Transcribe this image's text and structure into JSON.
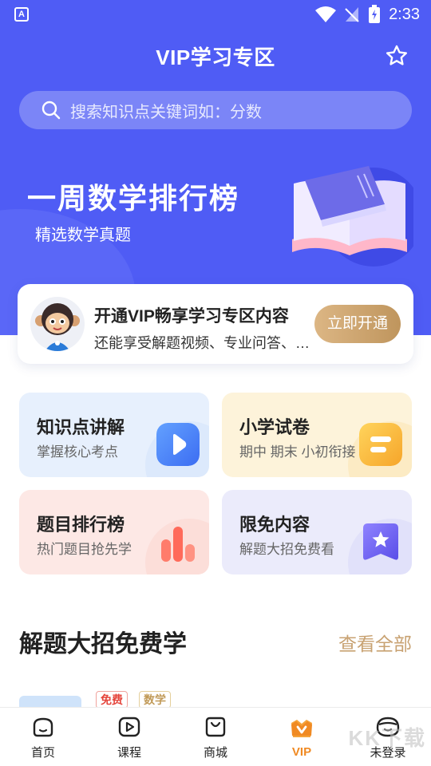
{
  "status_bar": {
    "time": "2:33",
    "notice_glyph": "A"
  },
  "header": {
    "title": "VIP学习专区"
  },
  "search": {
    "placeholder": "搜索知识点关键词如：分数"
  },
  "banner": {
    "title": "一周数学排行榜",
    "subtitle": "精选数学真题"
  },
  "vip_card": {
    "title": "开通VIP畅享学习专区内容",
    "description": "还能享受解题视频、专业问答、…",
    "button": "立即开通"
  },
  "tiles": [
    {
      "title": "知识点讲解",
      "subtitle": "掌握核心考点",
      "icon": "play-icon"
    },
    {
      "title": "小学试卷",
      "subtitle": "期中 期末 小初衔接",
      "icon": "paper-icon"
    },
    {
      "title": "题目排行榜",
      "subtitle": "热门题目抢先学",
      "icon": "bar-chart-icon"
    },
    {
      "title": "限免内容",
      "subtitle": "解题大招免费看",
      "icon": "star-badge-icon"
    }
  ],
  "section": {
    "title": "解题大招免费学",
    "more": "查看全部"
  },
  "preview_item": {
    "tags": [
      "免费",
      "数学"
    ]
  },
  "tabbar": {
    "items": [
      {
        "label": "首页",
        "icon": "home-icon"
      },
      {
        "label": "课程",
        "icon": "course-icon"
      },
      {
        "label": "商城",
        "icon": "shop-icon"
      },
      {
        "label": "VIP",
        "icon": "vip-icon",
        "active": true
      },
      {
        "label": "未登录",
        "icon": "profile-icon"
      }
    ]
  },
  "watermark": "KK下载",
  "colors": {
    "primary": "#4f5cf5",
    "gold": "#c8a272",
    "active_tab": "#f08a23"
  }
}
